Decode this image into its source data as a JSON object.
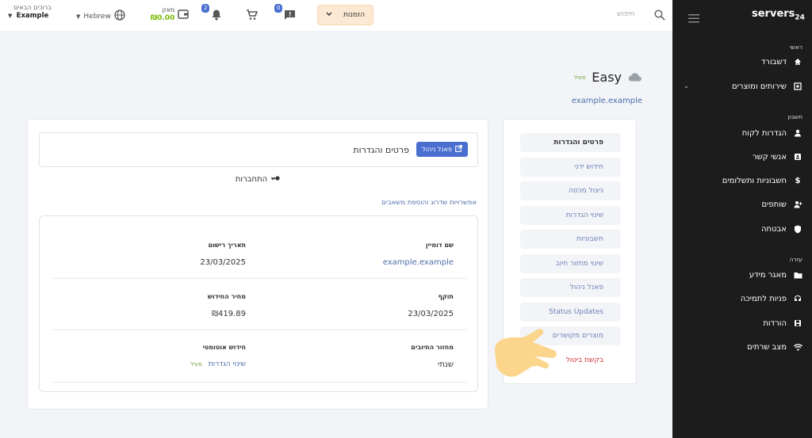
{
  "colors": {
    "accent": "#4a6fd1",
    "sidebar_bg": "#1c1c1c",
    "orders_bg": "#fde9d3",
    "active_green": "#6aa12b",
    "danger": "#d0302f"
  },
  "topbar": {
    "user_greeting": "ברוכים הבאים",
    "user_name": "Example",
    "language": "Hebrew",
    "balance_label": "מאזן",
    "balance_amount": "₪0.00",
    "notifications_count": "2",
    "messages_count": "0",
    "orders_label": "הזמנות",
    "search_placeholder": "חיפוש",
    "icons": [
      "globe-icon",
      "wallet-icon",
      "bell-icon",
      "cart-icon",
      "message-icon",
      "search-icon",
      "chevron-down-icon"
    ]
  },
  "sidebar": {
    "logo": "servers",
    "logo_suffix": "24",
    "sections": [
      {
        "label": "ראשי",
        "items": [
          {
            "label": "דשבורד",
            "icon": "home-icon"
          },
          {
            "label": "שירותים ומוצרים",
            "icon": "box-icon"
          }
        ]
      },
      {
        "label": "חשבון",
        "items": [
          {
            "label": "הגדרות לקוח",
            "icon": "user-icon"
          },
          {
            "label": "אנשי קשר",
            "icon": "contacts-icon"
          },
          {
            "label": "חשבוניות ותשלומים",
            "icon": "dollar-icon"
          },
          {
            "label": "שותפים",
            "icon": "user-plus-icon"
          },
          {
            "label": "אבטחה",
            "icon": "shield-icon"
          }
        ]
      },
      {
        "label": "עזרה",
        "items": [
          {
            "label": "מאגר מידע",
            "icon": "folder-icon"
          },
          {
            "label": "פניות לתמיכה",
            "icon": "support-icon"
          },
          {
            "label": "הורדות",
            "icon": "download-icon"
          },
          {
            "label": "מצב שרתים",
            "icon": "wifi-icon"
          }
        ]
      }
    ]
  },
  "domain": {
    "title": "Easy",
    "status": "פעיל",
    "subtitle": "example.example"
  },
  "details": {
    "title": "פרטים והגדרות",
    "panel_button": "פאנל ניהול",
    "connect_label": "התחברות",
    "upgrade_link": "אפשרויות שדרוג והוספת משאבים",
    "fields": {
      "domain_name_label": "שם דומיין",
      "domain_name_value": "example.example",
      "reg_date_label": "תאריך רישום",
      "reg_date_value": "23/03/2025",
      "expiry_label": "תוקף",
      "expiry_value": "23/03/2025",
      "renewal_price_label": "מחיר החידוש",
      "renewal_price_value": "₪419.89",
      "billing_cycle_label": "מחזור החיובים",
      "billing_cycle_value": "שנתי",
      "auto_renew_label": "חידוש אוטומטי",
      "auto_renew_status": "פעיל",
      "auto_renew_link": "שינוי הגדרות"
    }
  },
  "menu": {
    "items": [
      "פרטים והגדרות",
      "חידוש ידני",
      "ניצול מכסה",
      "שינוי הגדרות",
      "חשבוניות",
      "שינוי מחזור חיוב",
      "פאנל ניהול",
      "Status Updates",
      "מוצרים מקושרים",
      "בקשת ביטול"
    ]
  }
}
